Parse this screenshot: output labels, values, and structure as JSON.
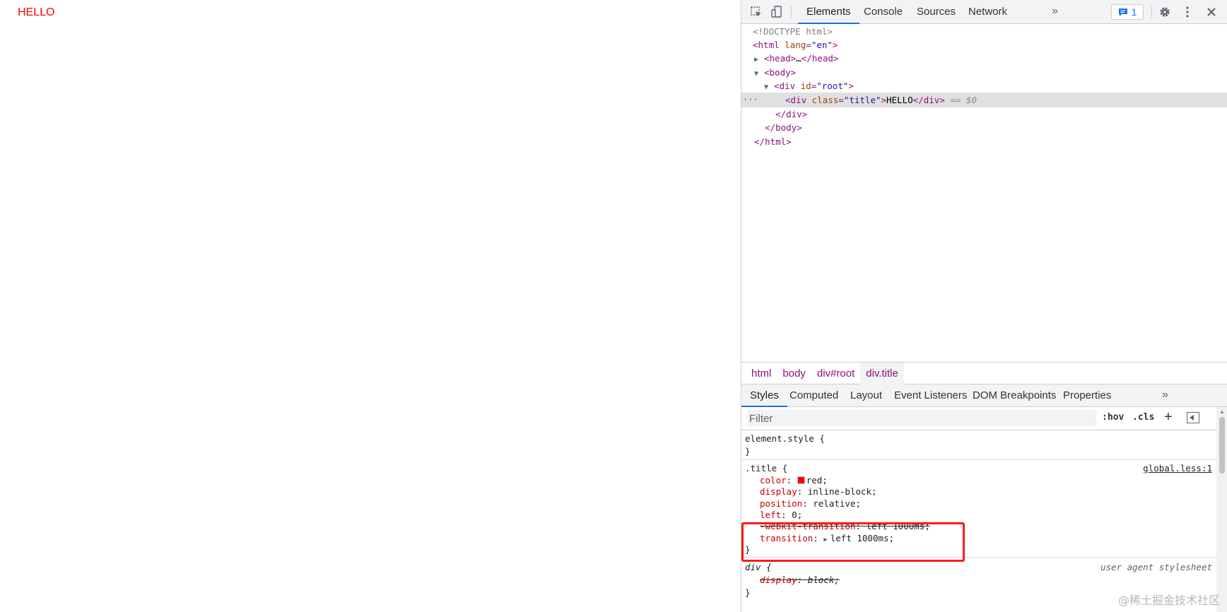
{
  "page": {
    "title_text": "HELLO"
  },
  "devtools": {
    "toolbar": {
      "inspect_icon": "inspect-cursor-icon",
      "device_icon": "device-toggle-icon",
      "tabs": [
        "Elements",
        "Console",
        "Sources",
        "Network"
      ],
      "active_tab": "Elements",
      "more_tabs": "»",
      "issues_count": "1",
      "gear": "settings-gear-icon",
      "kebab": "kebab-menu-icon",
      "close": "close-icon"
    },
    "tree": {
      "doctype": "<!DOCTYPE html>",
      "html_open_tag": "html",
      "html_lang_attr": "lang",
      "html_lang_val": "\"en\"",
      "head_tag": "head",
      "head_ellipsis": "…",
      "body_tag": "body",
      "div_tag": "div",
      "root_attr": "id",
      "root_val": "\"root\"",
      "title_attr": "class",
      "title_val": "\"title\"",
      "title_text": "HELLO",
      "eq_marker": " == $0",
      "ellipsis": "···"
    },
    "breadcrumb": [
      "html",
      "body",
      "div#root",
      "div.title"
    ],
    "style_tabs": [
      "Styles",
      "Computed",
      "Layout",
      "Event Listeners",
      "DOM Breakpoints",
      "Properties"
    ],
    "style_more": "»",
    "filter": {
      "placeholder": "Filter",
      "hov": ":hov",
      "cls": ".cls",
      "plus": "+"
    },
    "styles": {
      "element_style": "element.style {",
      "close_brace": "}",
      "title_rule": {
        "selector": ".title {",
        "source": "global.less:1",
        "props": [
          {
            "name": "color",
            "value": "red;",
            "swatch": "#ff0000"
          },
          {
            "name": "display",
            "value": "inline-block;"
          },
          {
            "name": "position",
            "value": "relative;"
          },
          {
            "name": "left",
            "value": "0;"
          },
          {
            "name": "-webkit-transition",
            "value": "left 1000ms;"
          },
          {
            "name": "transition",
            "value": "left 1000ms;"
          }
        ]
      },
      "div_rule": {
        "selector": "div {",
        "source": "user agent stylesheet",
        "props": [
          {
            "name": "display",
            "value": "block;"
          }
        ]
      }
    }
  },
  "watermark": "@稀土掘金技术社区",
  "colors": {
    "accent": "#1a73e8",
    "highlight": "#ff1a1a",
    "title_red": "#ff0000"
  }
}
